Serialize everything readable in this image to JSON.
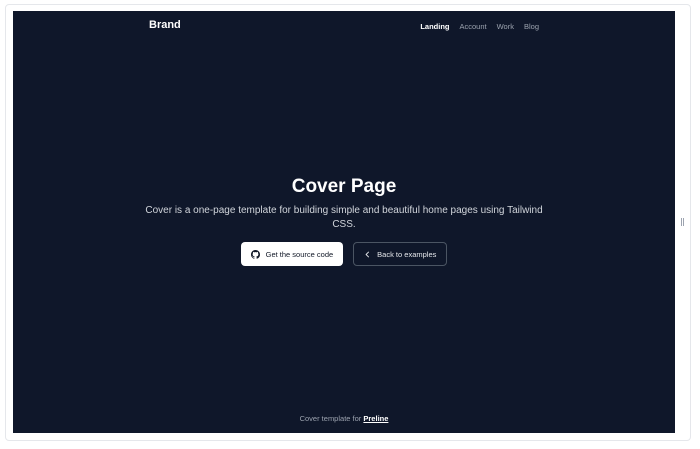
{
  "header": {
    "brand": "Brand",
    "nav": [
      {
        "label": "Landing",
        "active": true
      },
      {
        "label": "Account",
        "active": false
      },
      {
        "label": "Work",
        "active": false
      },
      {
        "label": "Blog",
        "active": false
      }
    ]
  },
  "hero": {
    "title": "Cover Page",
    "description": "Cover is a one-page template for building simple and beautiful home pages using Tailwind CSS.",
    "primary_button": {
      "label": "Get the source code",
      "icon": "github-icon"
    },
    "secondary_button": {
      "label": "Back to examples",
      "icon": "chevron-left-icon"
    }
  },
  "footer": {
    "prefix": "Cover template for",
    "link": "Preline"
  },
  "colors": {
    "background": "#0f172a",
    "text_primary": "#ffffff",
    "text_muted": "#9ca3af"
  }
}
